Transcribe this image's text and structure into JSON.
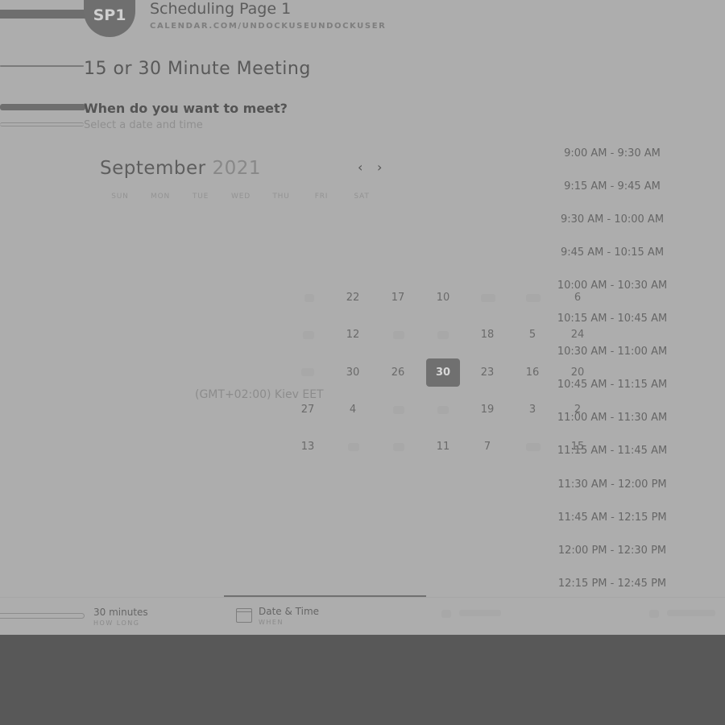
{
  "header": {
    "avatar_initials": "SP1",
    "title": "Scheduling Page 1",
    "subtitle": "CALENDAR.COM/UNDOCKUSEUNDOCKUSER"
  },
  "meeting_title": "15 or 30 Minute Meeting",
  "question": "When do you want to meet?",
  "hint": "Select a date and time",
  "calendar": {
    "month": "September",
    "year": "2021",
    "prev_icon": "‹",
    "next_icon": "›",
    "weekdays": [
      "SUN",
      "MON",
      "TUE",
      "WED",
      "THU",
      "FRI",
      "SAT"
    ],
    "rows": [
      [
        "",
        "22",
        "17",
        "10",
        "",
        "",
        "6"
      ],
      [
        "",
        "12",
        "",
        "",
        "18",
        "5",
        "24"
      ],
      [
        "",
        "30",
        "26",
        "30",
        "23",
        "16",
        "20"
      ],
      [
        "27",
        "4",
        "",
        "",
        "19",
        "3",
        "2"
      ],
      [
        "13",
        "",
        "",
        "11",
        "7",
        "",
        "15"
      ]
    ],
    "selected": "30"
  },
  "timezone": "(GMT+02:00) Kiev EET",
  "time_slots": [
    "9:00 AM - 9:30 AM",
    "9:15 AM - 9:45 AM",
    "9:30 AM - 10:00 AM",
    "9:45 AM - 10:15 AM",
    "10:00 AM - 10:30 AM",
    "10:15 AM - 10:45 AM",
    "10:30 AM - 11:00 AM",
    "10:45 AM - 11:15 AM",
    "11:00 AM - 11:30 AM",
    "11:15 AM - 11:45 AM",
    "11:30 AM - 12:00 PM",
    "11:45 AM - 12:15 PM",
    "12:00 PM - 12:30 PM",
    "12:15 PM - 12:45 PM"
  ],
  "steps": [
    {
      "label": "30 minutes",
      "sub": "HOW LONG"
    },
    {
      "label": "Date & Time",
      "sub": "WHEN"
    }
  ],
  "colors": {
    "page_bg": "#adadad",
    "outer_bg": "#585858",
    "selected_day": "#707070"
  }
}
